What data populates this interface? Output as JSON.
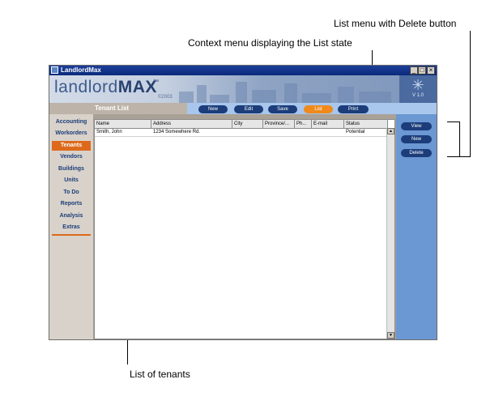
{
  "annotations": {
    "list_menu": "List menu with Delete button",
    "context_menu": "Context menu displaying the List state",
    "list_of_tenants": "List of tenants"
  },
  "window": {
    "title": "LandlordMax",
    "minimize": "_",
    "maximize": "□",
    "close": "×"
  },
  "banner": {
    "logo_light": "landlord",
    "logo_bold": "MAX",
    "tm": "™",
    "year": "©2003",
    "version": "V 1.0",
    "star": "✳"
  },
  "context_bar": {
    "title": "Tenant List",
    "buttons": [
      "New",
      "Edit",
      "Save",
      "List",
      "Print"
    ],
    "active": "List"
  },
  "sidebar": {
    "items": [
      "Accounting",
      "Workorders",
      "Tenants",
      "Vendors",
      "Buildings",
      "Units",
      "To Do",
      "Reports",
      "Analysis",
      "Extras"
    ],
    "active": "Tenants"
  },
  "grid": {
    "columns": [
      "Name",
      "Address",
      "City",
      "Province/...",
      "Ph...",
      "E-mail",
      "Status"
    ],
    "rows": [
      [
        "Smith, John",
        "1234 Somewhere Rd.",
        "",
        "",
        "",
        "",
        "Potential"
      ]
    ],
    "scroll_up": "▲",
    "scroll_down": "▼"
  },
  "right_panel": {
    "buttons": [
      "View",
      "New",
      "Delete"
    ]
  },
  "colors": {
    "accent_orange": "#f08a1c",
    "button_navy": "#1c3d7a",
    "panel_blue": "#6b97d2"
  }
}
